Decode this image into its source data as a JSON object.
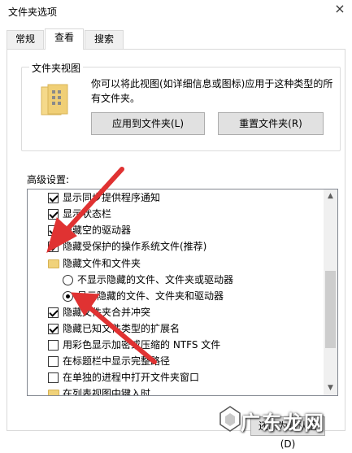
{
  "window": {
    "title": "文件夹选项",
    "close": "×"
  },
  "tabs": [
    {
      "label": "常规"
    },
    {
      "label": "查看"
    },
    {
      "label": "搜索"
    }
  ],
  "folder_views": {
    "group_title": "文件夹视图",
    "description": "你可以将此视图(如详细信息或图标)应用于这种类型的所有文件夹。",
    "apply_button": "应用到文件夹(L)",
    "reset_button": "重置文件夹(R)"
  },
  "advanced": {
    "label": "高级设置:",
    "items": [
      {
        "type": "checkbox",
        "checked": true,
        "label": "显示同步提供程序通知"
      },
      {
        "type": "checkbox",
        "checked": true,
        "label": "显示状态栏"
      },
      {
        "type": "checkbox",
        "checked": true,
        "label": "隐藏空的驱动器"
      },
      {
        "type": "checkbox",
        "checked": true,
        "label": "隐藏受保护的操作系统文件(推荐)"
      },
      {
        "type": "folder",
        "label": "隐藏文件和文件夹"
      },
      {
        "type": "radio",
        "checked": false,
        "label": "不显示隐藏的文件、文件夹或驱动器"
      },
      {
        "type": "radio",
        "checked": true,
        "label": "显示隐藏的文件、文件夹和驱动器"
      },
      {
        "type": "checkbox",
        "checked": true,
        "label": "隐藏文件夹合并冲突"
      },
      {
        "type": "checkbox",
        "checked": true,
        "label": "隐藏已知文件类型的扩展名"
      },
      {
        "type": "checkbox",
        "checked": false,
        "label": "用彩色显示加密或压缩的 NTFS 文件"
      },
      {
        "type": "checkbox",
        "checked": false,
        "label": "在标题栏中显示完整路径"
      },
      {
        "type": "checkbox",
        "checked": false,
        "label": "在单独的进程中打开文件夹窗口"
      },
      {
        "type": "folder",
        "label": "在列表视图中键入时"
      }
    ]
  },
  "bottom": {
    "restore_button": "还原为默认值(D)"
  },
  "watermark": {
    "text": "广东龙网"
  },
  "colors": {
    "arrow": "#e03232",
    "folder": "#f0d27a"
  }
}
